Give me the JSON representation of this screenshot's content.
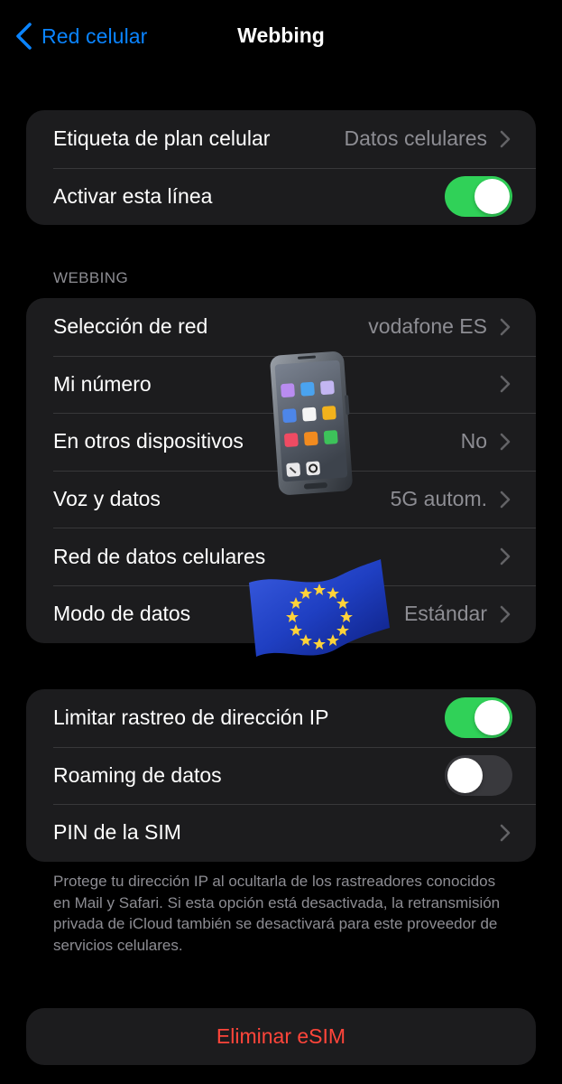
{
  "nav": {
    "back_label": "Red celular",
    "title": "Webbing"
  },
  "plan_group": {
    "plan_label": {
      "label": "Etiqueta de plan celular",
      "value": "Datos celulares"
    },
    "activate_line": {
      "label": "Activar esta línea",
      "toggle": "on"
    }
  },
  "webbing_section": {
    "header": "WEBBING",
    "rows": [
      {
        "label": "Selección de red",
        "value": "vodafone ES"
      },
      {
        "label": "Mi número",
        "value": ""
      },
      {
        "label": "En otros dispositivos",
        "value": "No"
      },
      {
        "label": "Voz y datos",
        "value": "5G autom."
      },
      {
        "label": "Red de datos celulares",
        "value": ""
      },
      {
        "label": "Modo de datos",
        "value": "Estándar"
      }
    ]
  },
  "privacy_group": {
    "limit_ip": {
      "label": "Limitar rastreo de dirección IP",
      "toggle": "on"
    },
    "roaming": {
      "label": "Roaming de datos",
      "toggle": "off"
    },
    "sim_pin": {
      "label": "PIN de la SIM"
    }
  },
  "footer_note": "Protege tu dirección IP al ocultarla de los rastreadores conocidos en Mail y Safari. Si esta opción está desactivada, la retransmisión privada de iCloud también se desactivará para este proveedor de servicios celulares.",
  "delete_esim": "Eliminar eSIM",
  "stickers": [
    "mobile-phone-emoji",
    "eu-flag-emoji"
  ],
  "colors": {
    "background": "#000000",
    "cell": "#1c1c1e",
    "accent_blue": "#0a84ff",
    "toggle_on": "#30d158",
    "destructive": "#ff453a",
    "secondary_text": "#8d8d93"
  }
}
